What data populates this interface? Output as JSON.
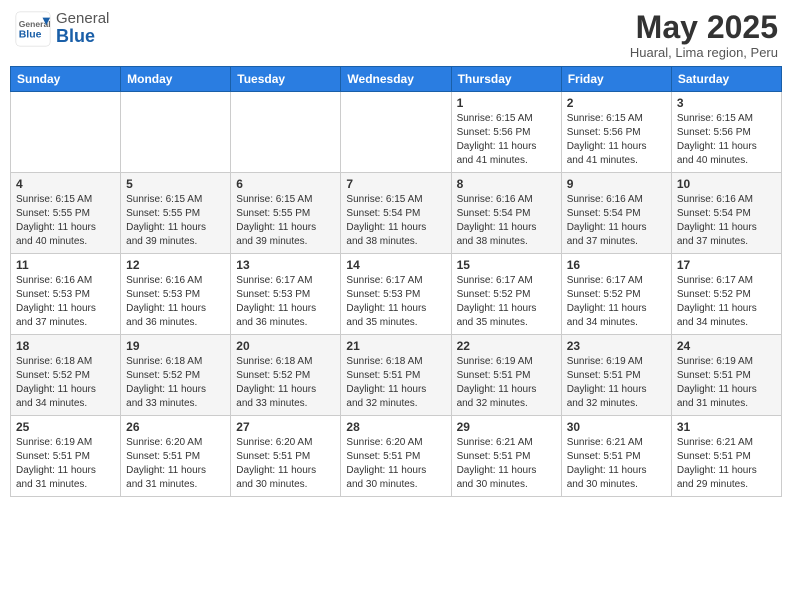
{
  "header": {
    "logo_general": "General",
    "logo_blue": "Blue",
    "month_title": "May 2025",
    "location": "Huaral, Lima region, Peru"
  },
  "weekdays": [
    "Sunday",
    "Monday",
    "Tuesday",
    "Wednesday",
    "Thursday",
    "Friday",
    "Saturday"
  ],
  "weeks": [
    {
      "days": [
        {
          "num": "",
          "info": ""
        },
        {
          "num": "",
          "info": ""
        },
        {
          "num": "",
          "info": ""
        },
        {
          "num": "",
          "info": ""
        },
        {
          "num": "1",
          "info": "Sunrise: 6:15 AM\nSunset: 5:56 PM\nDaylight: 11 hours\nand 41 minutes."
        },
        {
          "num": "2",
          "info": "Sunrise: 6:15 AM\nSunset: 5:56 PM\nDaylight: 11 hours\nand 41 minutes."
        },
        {
          "num": "3",
          "info": "Sunrise: 6:15 AM\nSunset: 5:56 PM\nDaylight: 11 hours\nand 40 minutes."
        }
      ]
    },
    {
      "days": [
        {
          "num": "4",
          "info": "Sunrise: 6:15 AM\nSunset: 5:55 PM\nDaylight: 11 hours\nand 40 minutes."
        },
        {
          "num": "5",
          "info": "Sunrise: 6:15 AM\nSunset: 5:55 PM\nDaylight: 11 hours\nand 39 minutes."
        },
        {
          "num": "6",
          "info": "Sunrise: 6:15 AM\nSunset: 5:55 PM\nDaylight: 11 hours\nand 39 minutes."
        },
        {
          "num": "7",
          "info": "Sunrise: 6:15 AM\nSunset: 5:54 PM\nDaylight: 11 hours\nand 38 minutes."
        },
        {
          "num": "8",
          "info": "Sunrise: 6:16 AM\nSunset: 5:54 PM\nDaylight: 11 hours\nand 38 minutes."
        },
        {
          "num": "9",
          "info": "Sunrise: 6:16 AM\nSunset: 5:54 PM\nDaylight: 11 hours\nand 37 minutes."
        },
        {
          "num": "10",
          "info": "Sunrise: 6:16 AM\nSunset: 5:54 PM\nDaylight: 11 hours\nand 37 minutes."
        }
      ]
    },
    {
      "days": [
        {
          "num": "11",
          "info": "Sunrise: 6:16 AM\nSunset: 5:53 PM\nDaylight: 11 hours\nand 37 minutes."
        },
        {
          "num": "12",
          "info": "Sunrise: 6:16 AM\nSunset: 5:53 PM\nDaylight: 11 hours\nand 36 minutes."
        },
        {
          "num": "13",
          "info": "Sunrise: 6:17 AM\nSunset: 5:53 PM\nDaylight: 11 hours\nand 36 minutes."
        },
        {
          "num": "14",
          "info": "Sunrise: 6:17 AM\nSunset: 5:53 PM\nDaylight: 11 hours\nand 35 minutes."
        },
        {
          "num": "15",
          "info": "Sunrise: 6:17 AM\nSunset: 5:52 PM\nDaylight: 11 hours\nand 35 minutes."
        },
        {
          "num": "16",
          "info": "Sunrise: 6:17 AM\nSunset: 5:52 PM\nDaylight: 11 hours\nand 34 minutes."
        },
        {
          "num": "17",
          "info": "Sunrise: 6:17 AM\nSunset: 5:52 PM\nDaylight: 11 hours\nand 34 minutes."
        }
      ]
    },
    {
      "days": [
        {
          "num": "18",
          "info": "Sunrise: 6:18 AM\nSunset: 5:52 PM\nDaylight: 11 hours\nand 34 minutes."
        },
        {
          "num": "19",
          "info": "Sunrise: 6:18 AM\nSunset: 5:52 PM\nDaylight: 11 hours\nand 33 minutes."
        },
        {
          "num": "20",
          "info": "Sunrise: 6:18 AM\nSunset: 5:52 PM\nDaylight: 11 hours\nand 33 minutes."
        },
        {
          "num": "21",
          "info": "Sunrise: 6:18 AM\nSunset: 5:51 PM\nDaylight: 11 hours\nand 32 minutes."
        },
        {
          "num": "22",
          "info": "Sunrise: 6:19 AM\nSunset: 5:51 PM\nDaylight: 11 hours\nand 32 minutes."
        },
        {
          "num": "23",
          "info": "Sunrise: 6:19 AM\nSunset: 5:51 PM\nDaylight: 11 hours\nand 32 minutes."
        },
        {
          "num": "24",
          "info": "Sunrise: 6:19 AM\nSunset: 5:51 PM\nDaylight: 11 hours\nand 31 minutes."
        }
      ]
    },
    {
      "days": [
        {
          "num": "25",
          "info": "Sunrise: 6:19 AM\nSunset: 5:51 PM\nDaylight: 11 hours\nand 31 minutes."
        },
        {
          "num": "26",
          "info": "Sunrise: 6:20 AM\nSunset: 5:51 PM\nDaylight: 11 hours\nand 31 minutes."
        },
        {
          "num": "27",
          "info": "Sunrise: 6:20 AM\nSunset: 5:51 PM\nDaylight: 11 hours\nand 30 minutes."
        },
        {
          "num": "28",
          "info": "Sunrise: 6:20 AM\nSunset: 5:51 PM\nDaylight: 11 hours\nand 30 minutes."
        },
        {
          "num": "29",
          "info": "Sunrise: 6:21 AM\nSunset: 5:51 PM\nDaylight: 11 hours\nand 30 minutes."
        },
        {
          "num": "30",
          "info": "Sunrise: 6:21 AM\nSunset: 5:51 PM\nDaylight: 11 hours\nand 30 minutes."
        },
        {
          "num": "31",
          "info": "Sunrise: 6:21 AM\nSunset: 5:51 PM\nDaylight: 11 hours\nand 29 minutes."
        }
      ]
    }
  ]
}
